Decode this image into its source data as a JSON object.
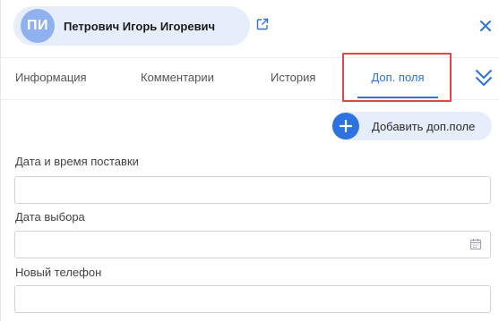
{
  "contact": {
    "initials": "ПИ",
    "name": "Петрович Игорь Игоревич",
    "avatar_color": "#8fb1f0",
    "chip_color": "#e7eefb"
  },
  "icons": {
    "open_link": "external-link-icon",
    "close": "close-icon",
    "more_tabs": "chevron-double-down-icon",
    "add": "plus-icon",
    "calendar": "calendar-icon"
  },
  "tabs": [
    {
      "label": "Информация",
      "active": false
    },
    {
      "label": "Комментарии",
      "active": false
    },
    {
      "label": "История",
      "active": false
    },
    {
      "label": "Доп. поля",
      "active": true
    }
  ],
  "add_field": {
    "label": "Добавить доп.поле"
  },
  "fields": [
    {
      "label": "Дата и время поставки",
      "value": ""
    },
    {
      "label": "Дата выбора",
      "value": ""
    },
    {
      "label": "Новый телефон",
      "value": ""
    }
  ],
  "colors": {
    "accent": "#2c72e0",
    "highlight": "#e0464a"
  }
}
